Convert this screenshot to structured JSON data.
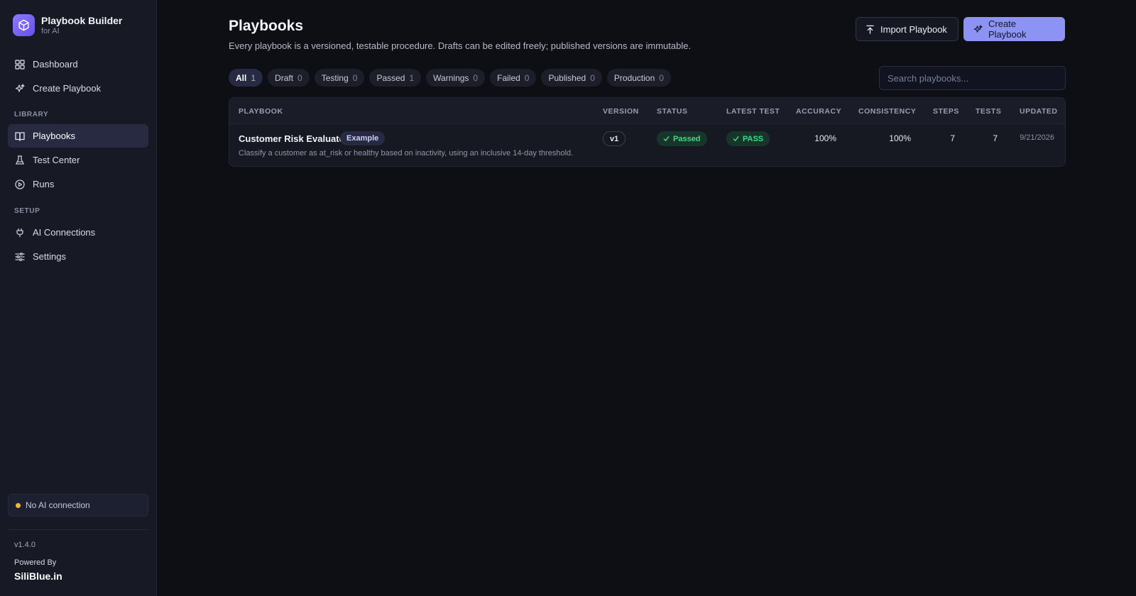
{
  "app": {
    "title": "Playbook Builder",
    "subtitle": "for AI"
  },
  "sidebar": {
    "top_items": [
      {
        "label": "Dashboard",
        "icon": "dashboard-grid-icon"
      },
      {
        "label": "Create Playbook",
        "icon": "sparkle-icon"
      }
    ],
    "library_heading": "LIBRARY",
    "library_items": [
      {
        "label": "Playbooks",
        "icon": "book-icon",
        "active": true
      },
      {
        "label": "Test Center",
        "icon": "flask-icon"
      },
      {
        "label": "Runs",
        "icon": "play-circle-icon"
      }
    ],
    "setup_heading": "SETUP",
    "setup_items": [
      {
        "label": "AI Connections",
        "icon": "plug-icon"
      },
      {
        "label": "Settings",
        "icon": "sliders-icon"
      }
    ],
    "connection_status": "No AI connection",
    "connection_color": "#f5b82e",
    "version": "v1.4.0",
    "powered_by_label": "Powered By",
    "powered_by_brand": "SiliBlue.in"
  },
  "header": {
    "title": "Playbooks",
    "subtitle": "Every playbook is a versioned, testable procedure. Drafts can be edited freely; published versions are immutable.",
    "import_label": "Import Playbook",
    "create_label": "Create Playbook",
    "accent_color": "#8d93f2"
  },
  "filters": [
    {
      "label": "All",
      "count": "1",
      "active": true
    },
    {
      "label": "Draft",
      "count": "0"
    },
    {
      "label": "Testing",
      "count": "0"
    },
    {
      "label": "Passed",
      "count": "1"
    },
    {
      "label": "Warnings",
      "count": "0"
    },
    {
      "label": "Failed",
      "count": "0"
    },
    {
      "label": "Published",
      "count": "0"
    },
    {
      "label": "Production",
      "count": "0"
    }
  ],
  "search": {
    "placeholder": "Search playbooks..."
  },
  "table": {
    "columns": {
      "playbook": "PLAYBOOK",
      "version": "VERSION",
      "status": "STATUS",
      "latest_test": "LATEST TEST",
      "accuracy": "ACCURACY",
      "consistency": "CONSISTENCY",
      "steps": "STEPS",
      "tests": "TESTS",
      "updated": "UPDATED"
    },
    "rows": [
      {
        "name": "Customer Risk Evaluator",
        "tag": "Example",
        "description": "Classify a customer as at_risk or healthy based on inactivity, using an inclusive 14-day threshold.",
        "version": "v1",
        "status": "Passed",
        "latest_test": "PASS",
        "accuracy": "100%",
        "consistency": "100%",
        "steps": "7",
        "tests": "7",
        "updated": "9/21/2026",
        "status_color": "#3ddc84"
      }
    ]
  }
}
